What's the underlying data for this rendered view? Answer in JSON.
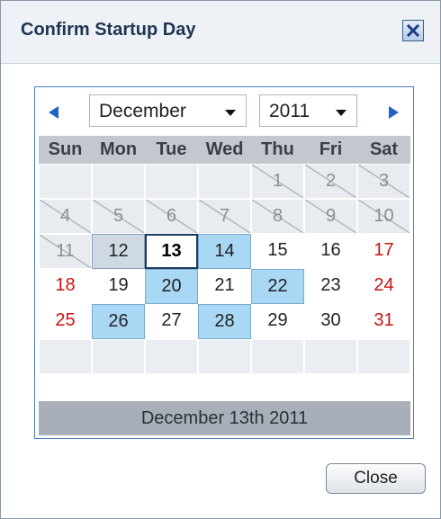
{
  "dialog": {
    "title": "Confirm Startup Day",
    "close_label": "Close",
    "close_icon": "close-icon"
  },
  "calendar": {
    "month": "December",
    "year": "2011",
    "weekdays": [
      "Sun",
      "Mon",
      "Tue",
      "Wed",
      "Thu",
      "Fri",
      "Sat"
    ],
    "weeks": [
      [
        "",
        "",
        "",
        "",
        "1",
        "2",
        "3"
      ],
      [
        "4",
        "5",
        "6",
        "7",
        "8",
        "9",
        "10"
      ],
      [
        "11",
        "12",
        "13",
        "14",
        "15",
        "16",
        "17"
      ],
      [
        "18",
        "19",
        "20",
        "21",
        "22",
        "23",
        "24"
      ],
      [
        "25",
        "26",
        "27",
        "28",
        "29",
        "30",
        "31"
      ],
      [
        "",
        "",
        "",
        "",
        "",
        "",
        ""
      ]
    ],
    "disabled_days": [
      "1",
      "2",
      "3",
      "4",
      "5",
      "6",
      "7",
      "8",
      "9",
      "10",
      "11"
    ],
    "highlighted_days": [
      "14",
      "20",
      "22",
      "26",
      "28"
    ],
    "highlighted_gray_days": [
      "12"
    ],
    "today": "13",
    "weekend_color": "#cc1111",
    "highlight_color": "#a9d8f5",
    "selected_text": "December 13th 2011"
  }
}
